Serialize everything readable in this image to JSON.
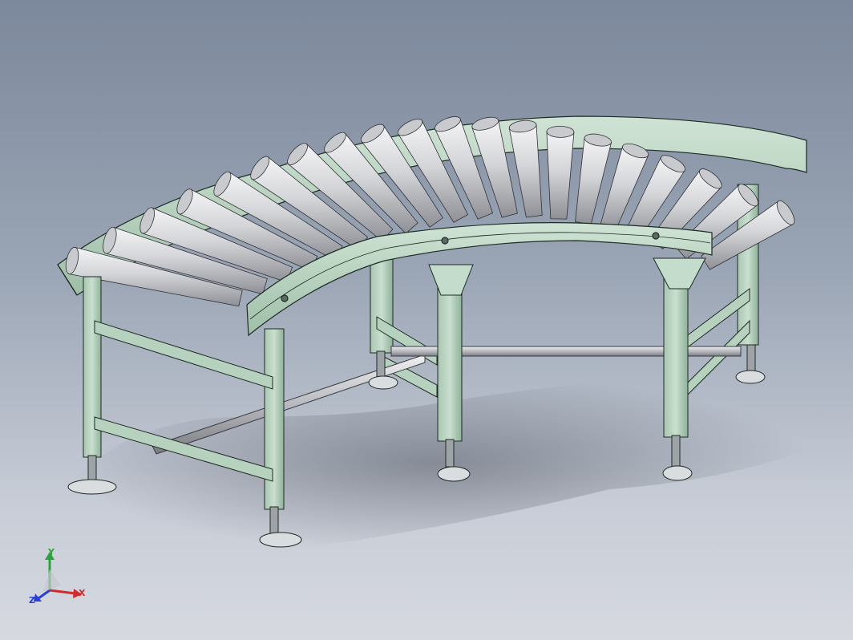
{
  "window": {
    "background_top": "#7c889b",
    "background_bottom": "#d6d9e0"
  },
  "model": {
    "subject": "curved-roller-conveyor",
    "frame_color": "#b9d3c1",
    "frame_edge_color": "#1e2a24",
    "roller_color": "#d8d9dc",
    "roller_count": 20,
    "leg_count": 6
  },
  "triad": {
    "x_label": "X",
    "y_label": "Y",
    "z_label": "Z",
    "x_color": "#d12b2b",
    "y_color": "#2aa43a",
    "z_color": "#2b3fd0"
  }
}
